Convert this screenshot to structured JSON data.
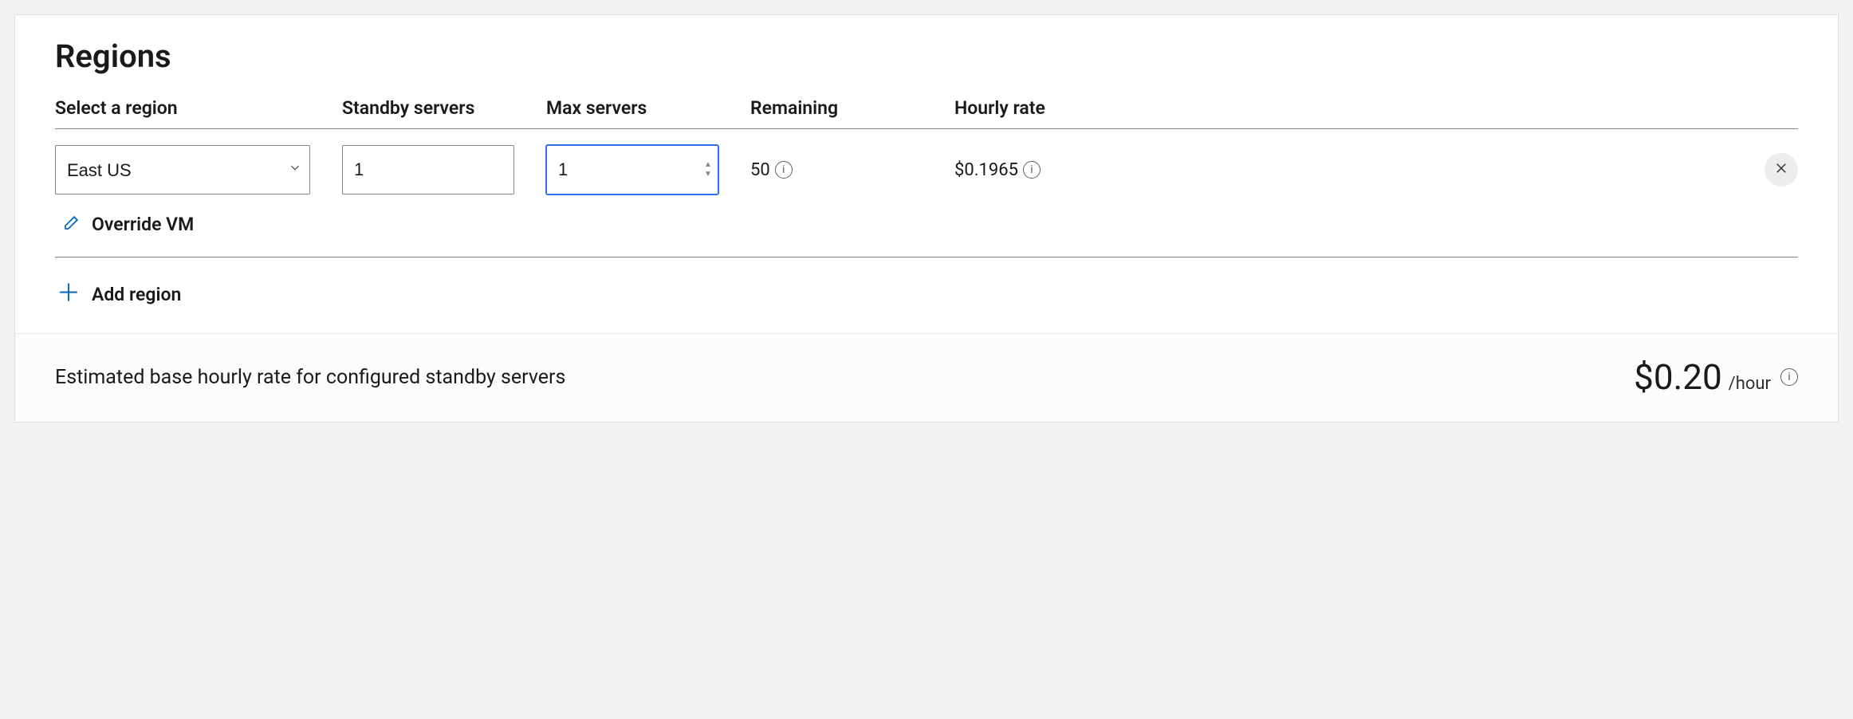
{
  "section": {
    "title": "Regions"
  },
  "headers": {
    "region": "Select a region",
    "standby": "Standby servers",
    "max": "Max servers",
    "remaining": "Remaining",
    "hourly": "Hourly rate"
  },
  "rows": [
    {
      "region": "East US",
      "standby": "1",
      "max": "1",
      "remaining": "50",
      "hourly": "$0.1965"
    }
  ],
  "actions": {
    "override_vm": "Override VM",
    "add_region": "Add region"
  },
  "footer": {
    "label": "Estimated base hourly rate for configured standby servers",
    "amount": "$0.20",
    "per": "/hour"
  }
}
